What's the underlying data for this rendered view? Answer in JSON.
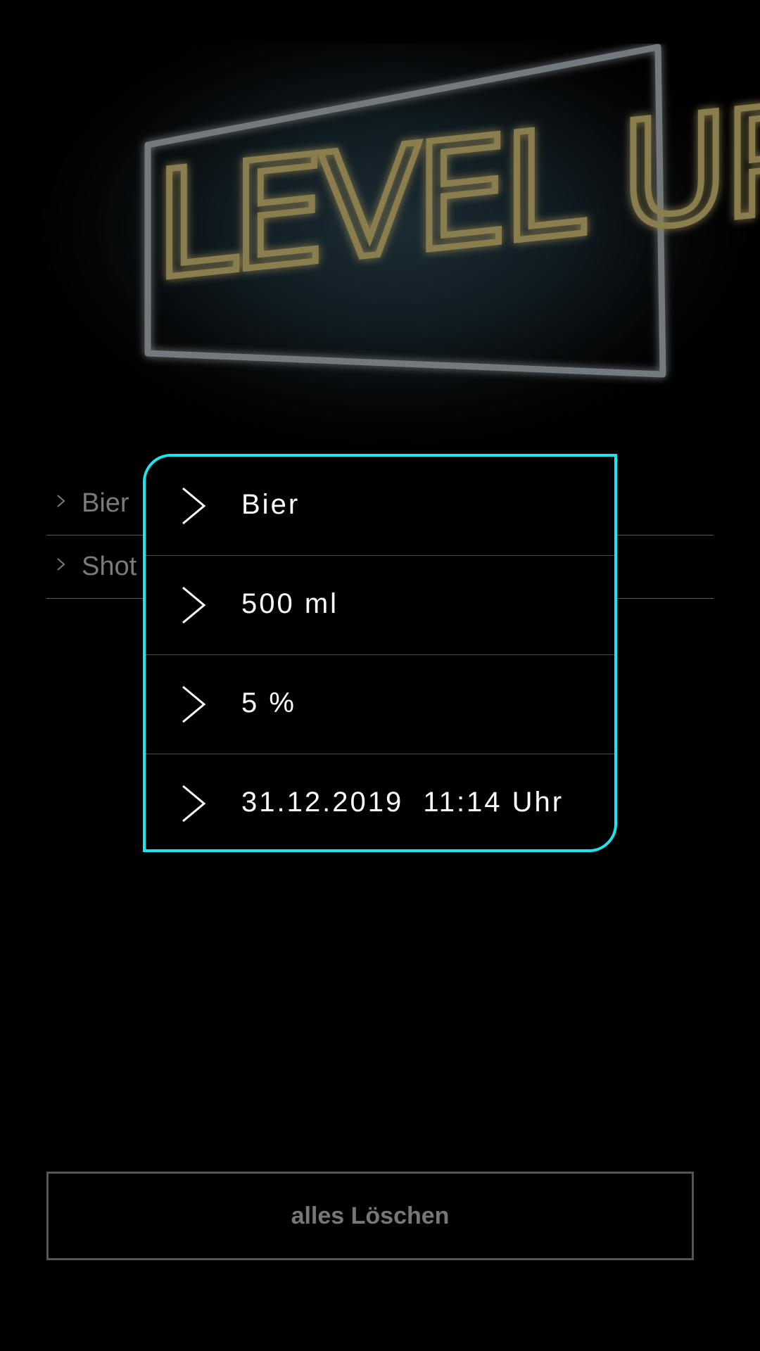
{
  "background_list": {
    "items": [
      {
        "label": "Bier"
      },
      {
        "label": "Shot"
      }
    ]
  },
  "popup": {
    "accent_color": "#19e6ee",
    "rows": [
      {
        "text": "Bier",
        "icon": "chevron-right-icon"
      },
      {
        "text": "500 ml",
        "icon": "chevron-right-icon"
      },
      {
        "text": "5 %",
        "icon": "chevron-right-icon"
      },
      {
        "text": "31.12.2019  11:14 Uhr",
        "icon": "chevron-right-icon"
      }
    ]
  },
  "footer": {
    "clear_all_label": "alles Löschen"
  },
  "hero": {
    "neon_text": "LEVEL UP"
  }
}
